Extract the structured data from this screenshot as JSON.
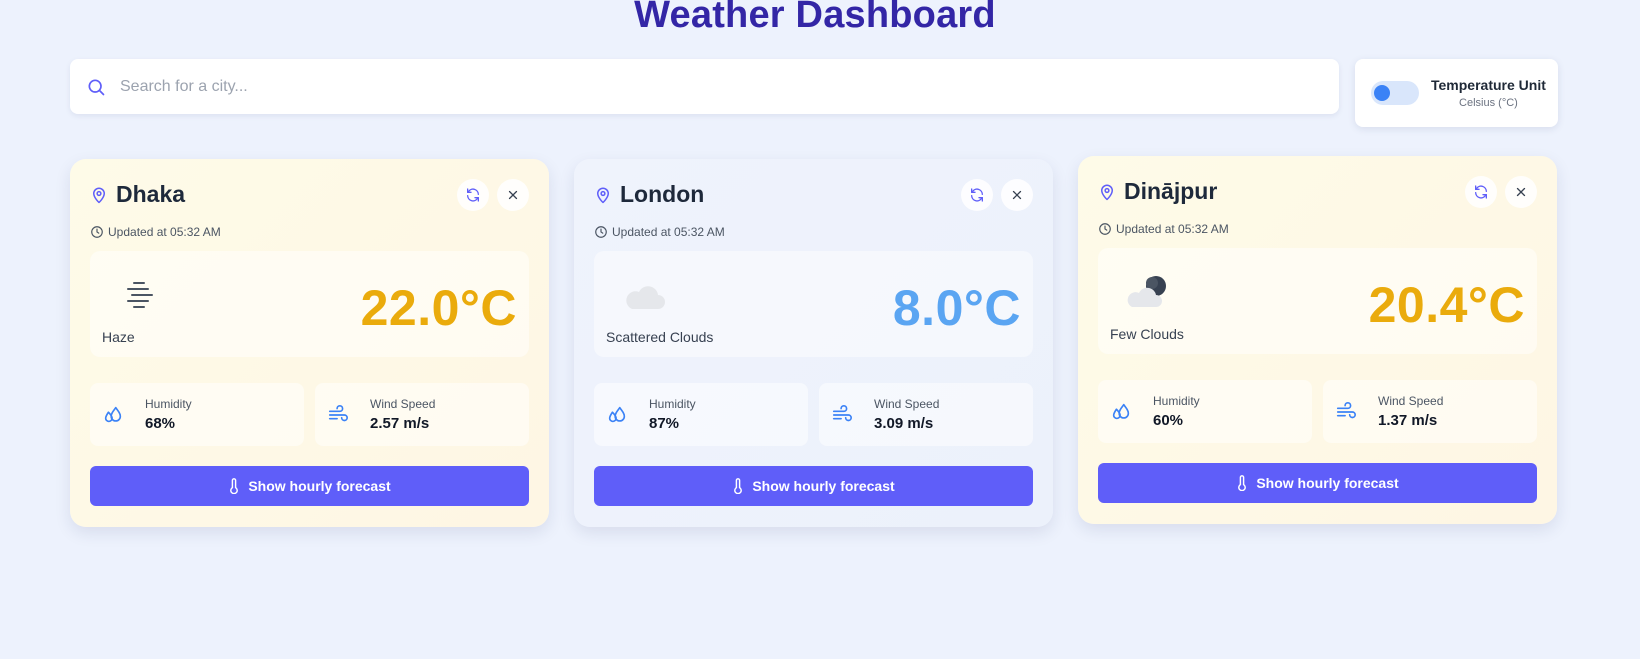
{
  "page": {
    "title": "Weather Dashboard"
  },
  "search": {
    "placeholder": "Search for a city..."
  },
  "unit_toggle": {
    "label": "Temperature Unit",
    "value": "Celsius (°C)"
  },
  "colors": {
    "title": "#3326a6",
    "accent": "#5f5ef9",
    "toggle_knob": "#3b82f6",
    "temp_warm": "#eaab0c",
    "temp_cool": "#5aa5f2",
    "icon_blue": "#3b82f6"
  },
  "cards": [
    {
      "city": "Dhaka",
      "updated": "Updated at 05:32 AM",
      "condition": "Haze",
      "condition_icon": "haze-icon",
      "temperature": "22.0°C",
      "humidity_label": "Humidity",
      "humidity": "68%",
      "wind_label": "Wind Speed",
      "wind": "2.57 m/s",
      "forecast_button": "Show hourly forecast"
    },
    {
      "city": "London",
      "updated": "Updated at 05:32 AM",
      "condition": "Scattered Clouds",
      "condition_icon": "cloud-icon",
      "temperature": "8.0°C",
      "humidity_label": "Humidity",
      "humidity": "87%",
      "wind_label": "Wind Speed",
      "wind": "3.09 m/s",
      "forecast_button": "Show hourly forecast"
    },
    {
      "city": "Dinājpur",
      "updated": "Updated at 05:32 AM",
      "condition": "Few Clouds",
      "condition_icon": "moon-cloud-icon",
      "temperature": "20.4°C",
      "humidity_label": "Humidity",
      "humidity": "60%",
      "wind_label": "Wind Speed",
      "wind": "1.37 m/s",
      "forecast_button": "Show hourly forecast"
    }
  ]
}
